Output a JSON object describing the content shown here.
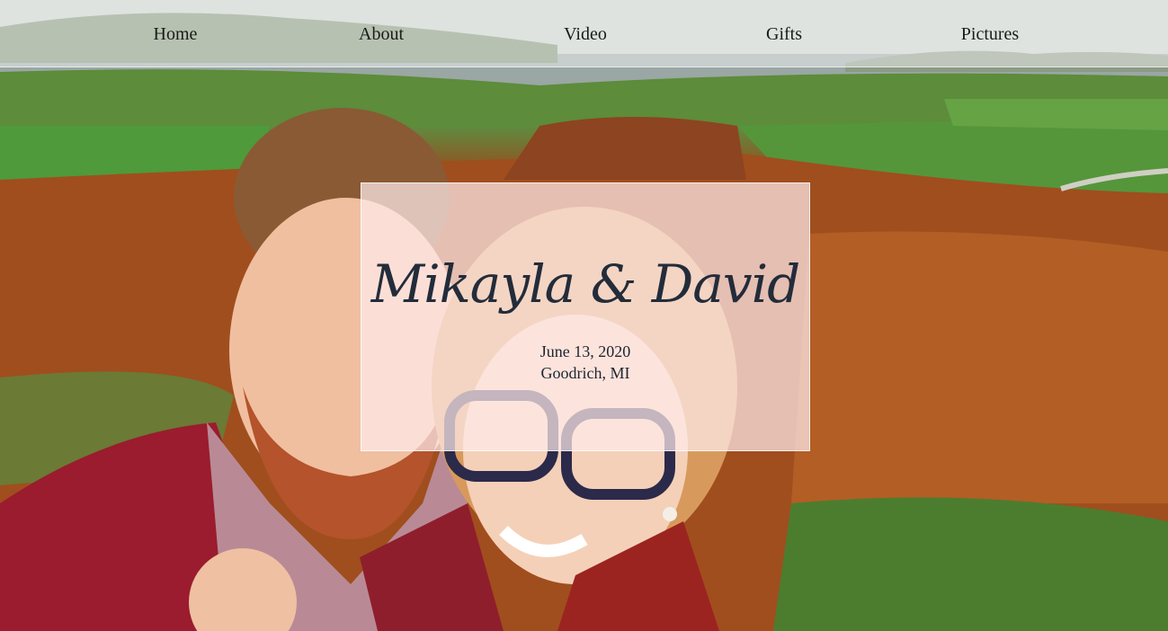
{
  "nav": {
    "items": [
      {
        "label": "Home"
      },
      {
        "label": "About"
      },
      {
        "label": "Video"
      },
      {
        "label": "Gifts"
      },
      {
        "label": "Pictures"
      }
    ]
  },
  "hero": {
    "names": "Mikayla & David",
    "date": "June 13, 2020",
    "location": "Goodrich, MI"
  },
  "colors": {
    "nav_background": "rgba(255,255,255,0.45)",
    "card_background": "#ffecec",
    "text": "#232c3a"
  }
}
